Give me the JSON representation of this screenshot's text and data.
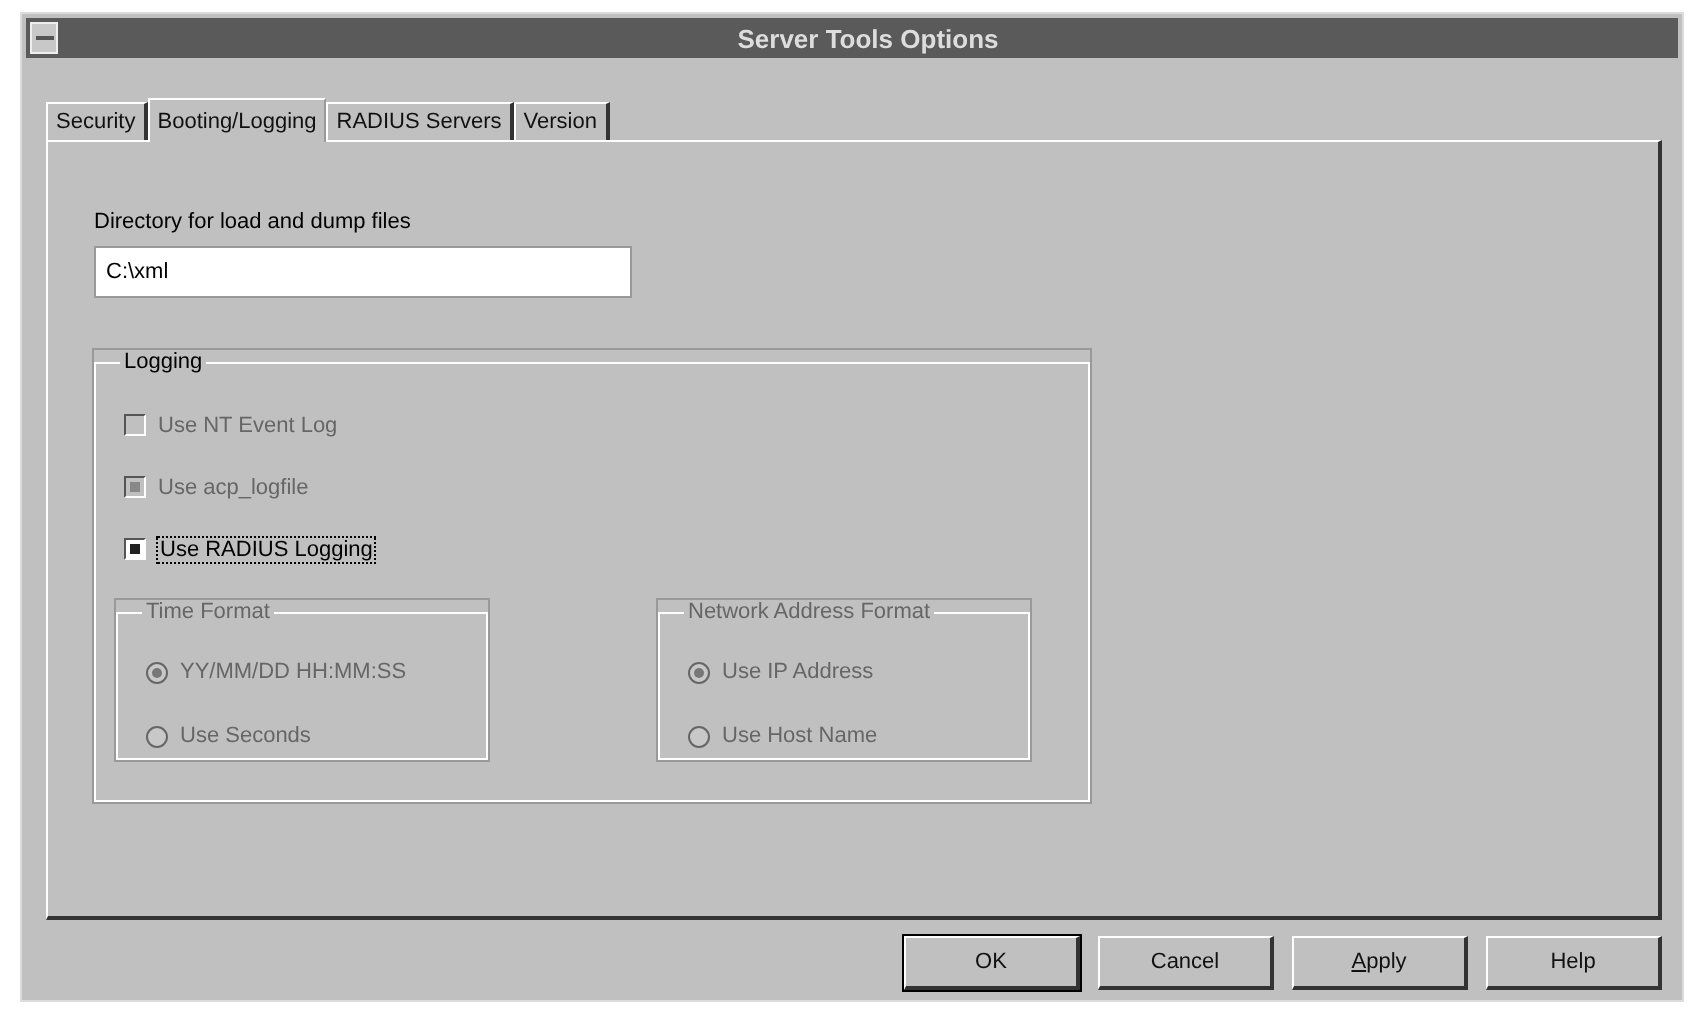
{
  "window": {
    "title": "Server Tools Options"
  },
  "tabs": [
    {
      "label": "Security",
      "selected": false
    },
    {
      "label": "Booting/Logging",
      "selected": true
    },
    {
      "label": "RADIUS Servers",
      "selected": false
    },
    {
      "label": "Version",
      "selected": false
    }
  ],
  "directory": {
    "label": "Directory for load and dump files",
    "value": "C:\\xml"
  },
  "logging": {
    "title": "Logging",
    "checkboxes": [
      {
        "label": "Use NT Event Log",
        "checked": false,
        "disabled": true,
        "focused": false
      },
      {
        "label": "Use acp_logfile",
        "checked": true,
        "disabled": true,
        "focused": false
      },
      {
        "label": "Use RADIUS Logging",
        "checked": true,
        "disabled": false,
        "focused": true
      }
    ],
    "groups": [
      {
        "title": "Time Format",
        "disabled": true,
        "options": [
          {
            "label": "YY/MM/DD HH:MM:SS",
            "selected": true
          },
          {
            "label": "Use Seconds",
            "selected": false
          }
        ]
      },
      {
        "title": "Network Address Format",
        "disabled": true,
        "options": [
          {
            "label": "Use IP Address",
            "selected": true
          },
          {
            "label": "Use Host Name",
            "selected": false
          }
        ]
      }
    ]
  },
  "buttons": [
    {
      "label": "OK",
      "default": true,
      "underline_first": false
    },
    {
      "label": "Cancel",
      "default": false,
      "underline_first": false
    },
    {
      "label": "Apply",
      "default": false,
      "underline_first": true
    },
    {
      "label": "Help",
      "default": false,
      "underline_first": false
    }
  ]
}
